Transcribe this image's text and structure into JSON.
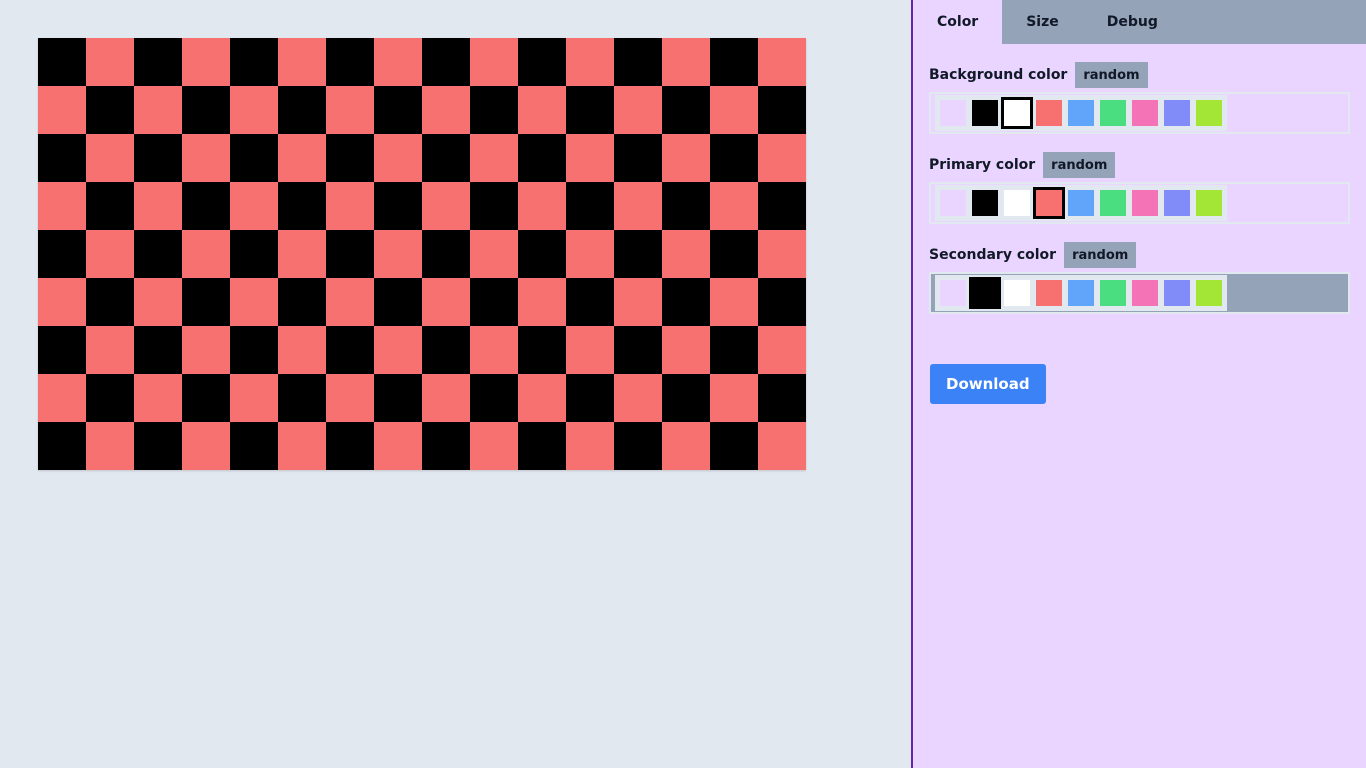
{
  "pattern": {
    "colors": [
      "#000000",
      "#f87171"
    ],
    "columns": 16,
    "rows": 9
  },
  "tabs": [
    {
      "label": "Color",
      "active": true
    },
    {
      "label": "Size",
      "active": false
    },
    {
      "label": "Debug",
      "active": false
    }
  ],
  "palette": [
    "#e9d5ff",
    "#000000",
    "#ffffff",
    "#f87171",
    "#60a5fa",
    "#4ade80",
    "#f472b6",
    "#818cf8",
    "#a3e635"
  ],
  "sections": [
    {
      "label": "Background color",
      "random_label": "random",
      "selected_index": 2
    },
    {
      "label": "Primary color",
      "random_label": "random",
      "selected_index": 3
    },
    {
      "label": "Secondary color",
      "random_label": "random",
      "selected_index": 1
    }
  ],
  "download_label": "Download"
}
